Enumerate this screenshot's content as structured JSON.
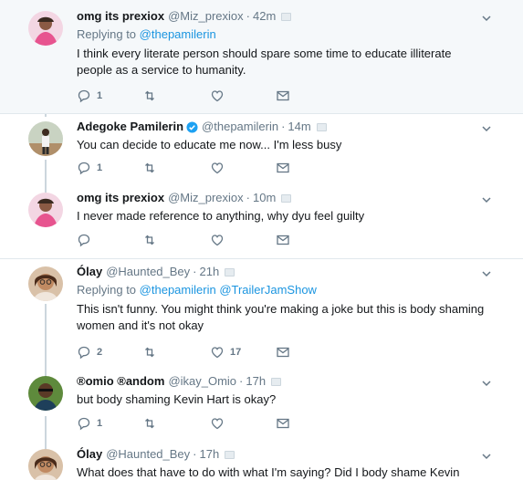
{
  "tweets": [
    {
      "name": "omg its prexiox",
      "handle": "@Miz_prexiox",
      "time": "42m",
      "verified": false,
      "reply_label": "Replying to",
      "reply_mentions": [
        "@thepamilerin"
      ],
      "text": "I think every literate person should spare some time to educate illiterate people as a service to humanity.",
      "replies": "1",
      "retweets": "",
      "likes": ""
    },
    {
      "name": "Adegoke Pamilerin",
      "handle": "@thepamilerin",
      "time": "14m",
      "verified": true,
      "text": "You can decide to educate me now... I'm less busy",
      "replies": "1",
      "retweets": "",
      "likes": ""
    },
    {
      "name": "omg its prexiox",
      "handle": "@Miz_prexiox",
      "time": "10m",
      "verified": false,
      "text": "I never made reference to anything, why dyu feel guilty",
      "replies": "",
      "retweets": "",
      "likes": ""
    },
    {
      "name": "Ólay",
      "handle": "@Haunted_Bey",
      "time": "21h",
      "verified": false,
      "reply_label": "Replying to",
      "reply_mentions": [
        "@thepamilerin",
        "@TrailerJamShow"
      ],
      "text": "This isn't funny. You might think you're making a joke but this is body shaming women and it's not okay",
      "replies": "2",
      "retweets": "",
      "likes": "17"
    },
    {
      "name": "®omio ®andom",
      "handle": "@ikay_Omio",
      "time": "17h",
      "verified": false,
      "text": "but body shaming Kevin Hart is okay?",
      "replies": "1",
      "retweets": "",
      "likes": ""
    },
    {
      "name": "Ólay",
      "handle": "@Haunted_Bey",
      "time": "17h",
      "verified": false,
      "text": "What does that have to do with what I'm saying? Did I body shame Kevin",
      "replies": "",
      "retweets": "",
      "likes": ""
    }
  ],
  "colors": {
    "link": "#1b95e0",
    "muted": "#657786",
    "verified": "#1da1f2",
    "highlight_bg": "#f5f8fa",
    "divider": "#e1e8ed"
  }
}
